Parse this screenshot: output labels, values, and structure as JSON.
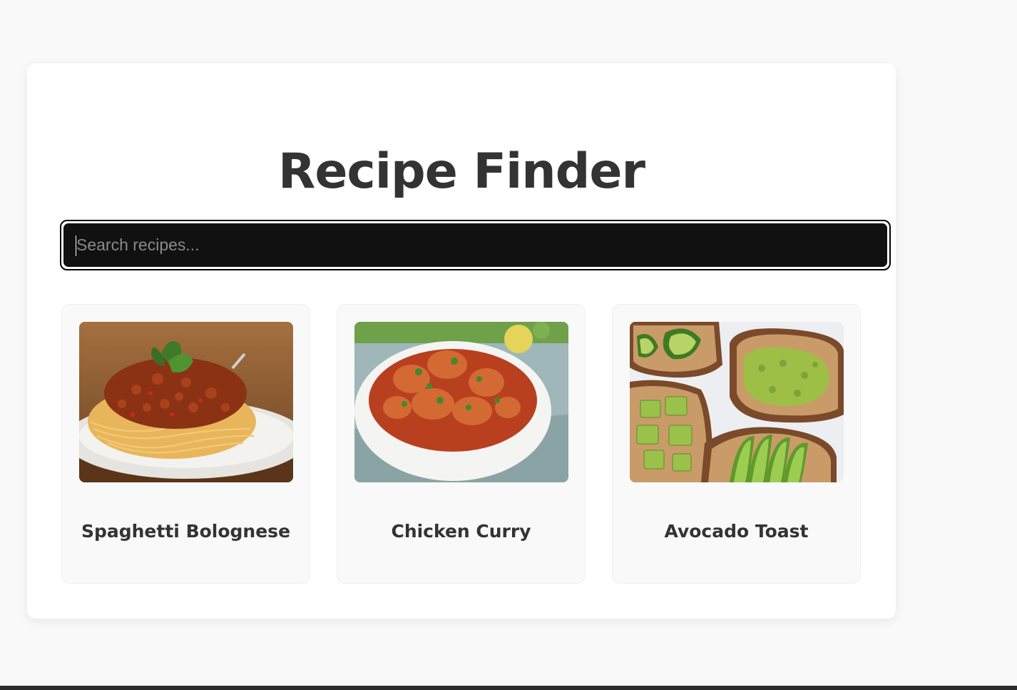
{
  "app": {
    "title": "Recipe Finder"
  },
  "search": {
    "placeholder": "Search recipes...",
    "value": ""
  },
  "recipes": [
    {
      "name": "Spaghetti Bolognese",
      "image": "spaghetti-bolognese-photo"
    },
    {
      "name": "Chicken Curry",
      "image": "chicken-curry-photo"
    },
    {
      "name": "Avocado Toast",
      "image": "avocado-toast-photo"
    }
  ],
  "colors": {
    "page_background": "#f9f9f9",
    "card_background": "#ffffff",
    "search_background": "#111111",
    "text": "#333333"
  }
}
